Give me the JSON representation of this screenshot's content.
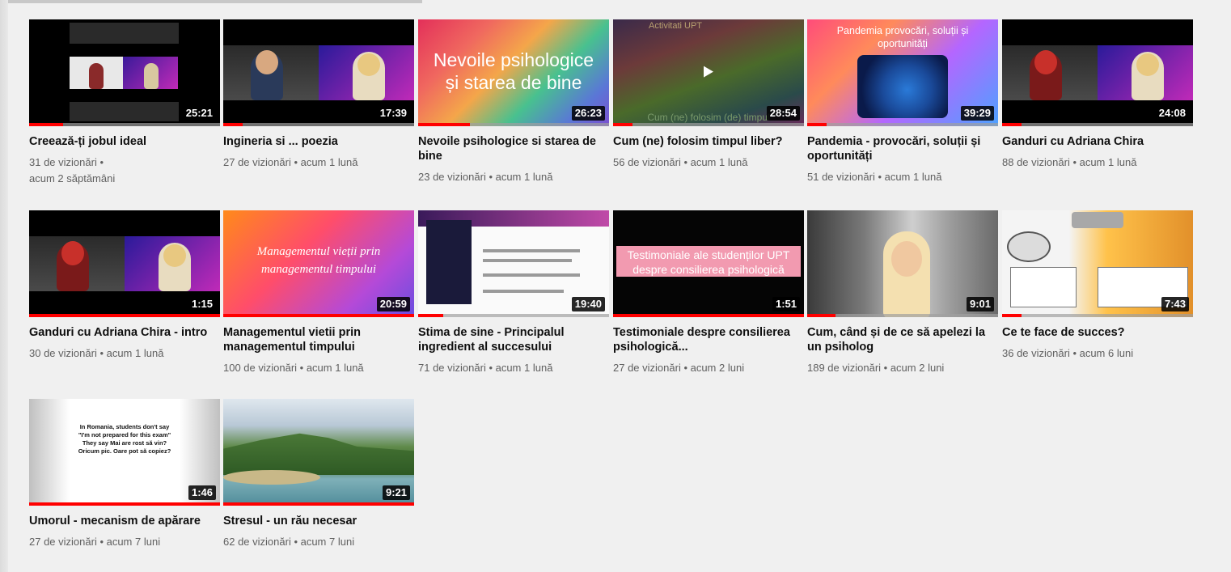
{
  "videos": [
    {
      "title": "Creează-ți jobul ideal",
      "views": "31 de vizionări •",
      "age": "acum 2 săptămâni",
      "duration": "25:21",
      "progress": 0.18,
      "thumb": "video-call"
    },
    {
      "title": "Ingineria si ... poezia",
      "views": "27 de vizionări • acum 1 lună",
      "age": "",
      "duration": "17:39",
      "progress": 0.1,
      "thumb": "video-call"
    },
    {
      "title": "Nevoile psihologice si starea de bine",
      "views": "23 de vizionări • acum 1 lună",
      "age": "",
      "duration": "26:23",
      "progress": 0.27,
      "thumb": "title-card",
      "thumb_text": "Nevoile psihologice și starea de bine"
    },
    {
      "title": "Cum (ne) folosim timpul liber?",
      "views": "56 de vizionări • acum 1 lună",
      "age": "",
      "duration": "28:54",
      "progress": 0.1,
      "thumb": "player",
      "thumb_text_top": "Activitati UPT",
      "thumb_text_bottom": "Cum (ne) folosim (de) timpul"
    },
    {
      "title": "Pandemia - provocări, soluții și oportunități",
      "views": "51 de vizionări • acum 1 lună",
      "age": "",
      "duration": "39:29",
      "progress": 0.1,
      "thumb": "covid",
      "thumb_text": "Pandemia provocări, soluții și oportunități"
    },
    {
      "title": "Ganduri cu Adriana Chira",
      "views": "88 de vizionări • acum 1 lună",
      "age": "",
      "duration": "24:08",
      "progress": 0.1,
      "thumb": "video-call"
    },
    {
      "title": "Ganduri cu Adriana Chira - intro",
      "views": "30 de vizionări • acum 1 lună",
      "age": "",
      "duration": "1:15",
      "progress": 1.0,
      "thumb": "video-call"
    },
    {
      "title": "Managementul vietii prin managementul timpului",
      "views": "100 de vizionări • acum 1 lună",
      "age": "",
      "duration": "20:59",
      "progress": 1.0,
      "thumb": "title-card-script",
      "thumb_text": "Managementul vieții prin managementul timpului"
    },
    {
      "title": "Stima de sine - Principalul ingredient al succesului",
      "views": "71 de vizionări • acum 1 lună",
      "age": "",
      "duration": "19:40",
      "progress": 0.13,
      "thumb": "slide"
    },
    {
      "title": "Testimoniale despre consilierea psihologică...",
      "views": "27 de vizionări • acum 2 luni",
      "age": "",
      "duration": "1:51",
      "progress": 1.0,
      "thumb": "black-title",
      "thumb_text": "Testimoniale ale studenților UPT despre consilierea psihologică"
    },
    {
      "title": "Cum, când și de ce să apelezi la un psiholog",
      "views": "189 de vizionări • acum 2 luni",
      "age": "",
      "duration": "9:01",
      "progress": 0.15,
      "thumb": "portrait"
    },
    {
      "title": "Ce te face de succes?",
      "views": "36 de vizionări • acum 6 luni",
      "age": "",
      "duration": "7:43",
      "progress": 0.1,
      "thumb": "success"
    },
    {
      "title": "Umorul - mecanism de apărare",
      "views": "27 de vizionări • acum 7 luni",
      "age": "",
      "duration": "1:46",
      "progress": 1.0,
      "thumb": "quote",
      "thumb_text": "In Romania, students don't say \"I'm not prepared for this exam\" They say Mai are rost să vin? Oricum pic. Oare pot să copiez?"
    },
    {
      "title": "Stresul - un rău necesar",
      "views": "62 de vizionări • acum 7 luni",
      "age": "",
      "duration": "9:21",
      "progress": 1.0,
      "thumb": "landscape"
    }
  ]
}
